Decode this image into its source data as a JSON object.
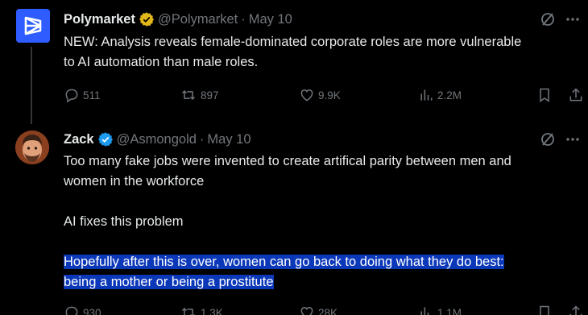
{
  "tweets": [
    {
      "name": "Polymarket",
      "handle": "@Polymarket",
      "sep": "·",
      "date": "May 10",
      "lines": [
        "NEW: Analysis reveals female-dominated corporate roles are more vulnerable",
        "to AI automation than male roles."
      ],
      "replies": "511",
      "reposts": "897",
      "likes": "9.9K",
      "views": "2.2M",
      "badge_color": "#e2b719",
      "avatar_color": "#2e5cff"
    },
    {
      "name": "Zack",
      "handle": "@Asmongold",
      "sep": "·",
      "date": "May 10",
      "para1": [
        "Too many fake jobs were invented to create artifical parity between men and",
        "women in the workforce"
      ],
      "para2": "AI fixes this problem",
      "para3": [
        "Hopefully after this is over, women can go back to doing what they do best:",
        "being a mother or being a prostitute"
      ],
      "replies": "930",
      "reposts": "1.3K",
      "likes": "28K",
      "views": "1.1M",
      "badge_color": "#1d9bf0",
      "highlight_color": "#0b38b8"
    }
  ],
  "icons": {
    "verified": "verified-badge-icon",
    "grok": "grok-icon",
    "more": "more-icon",
    "reply": "reply-icon",
    "repost": "repost-icon",
    "like": "heart-icon",
    "views": "views-icon",
    "bookmark": "bookmark-icon",
    "share": "share-icon"
  }
}
